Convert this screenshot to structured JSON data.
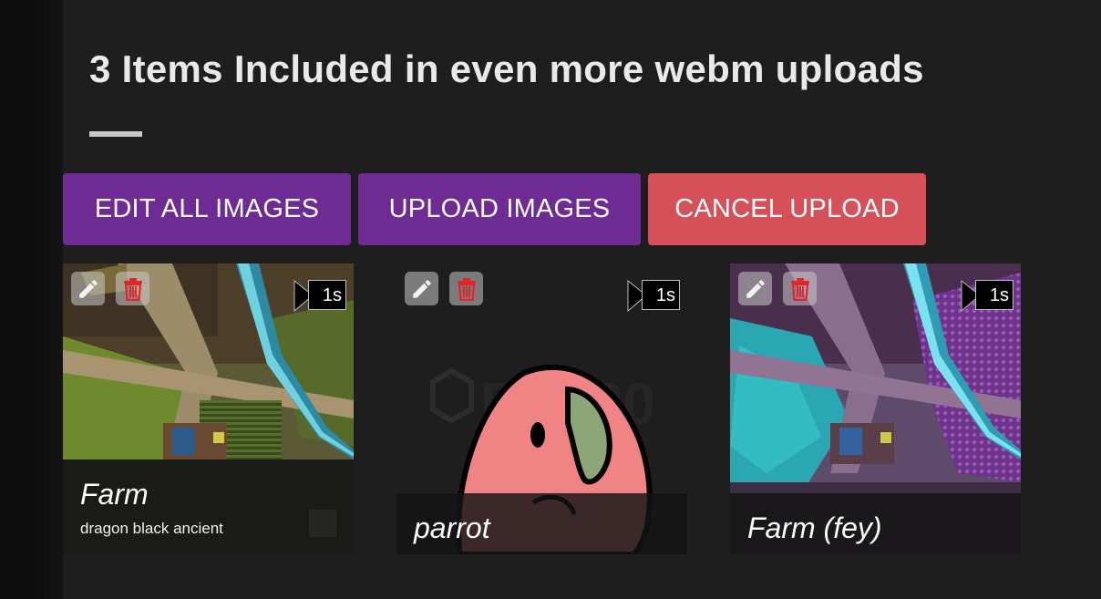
{
  "header": {
    "title": "3 Items Included in even more webm uploads"
  },
  "toolbar": {
    "edit_all_label": "EDIT ALL IMAGES",
    "upload_label": "UPLOAD IMAGES",
    "cancel_label": "CANCEL UPLOAD"
  },
  "colors": {
    "background": "#1e1e1e",
    "button_purple": "#6e2b93",
    "button_red": "#d6505a",
    "delete_icon_red": "#e0262b"
  },
  "items": [
    {
      "name": "Farm",
      "tags": "dragon black ancient",
      "duration": "1s",
      "edit_icon": "pencil-icon",
      "delete_icon": "trash-icon"
    },
    {
      "name": "parrot",
      "tags": "",
      "duration": "1s",
      "edit_icon": "pencil-icon",
      "delete_icon": "trash-icon"
    },
    {
      "name": "Farm (fey)",
      "tags": "",
      "duration": "1s",
      "edit_icon": "pencil-icon",
      "delete_icon": "trash-icon"
    }
  ]
}
